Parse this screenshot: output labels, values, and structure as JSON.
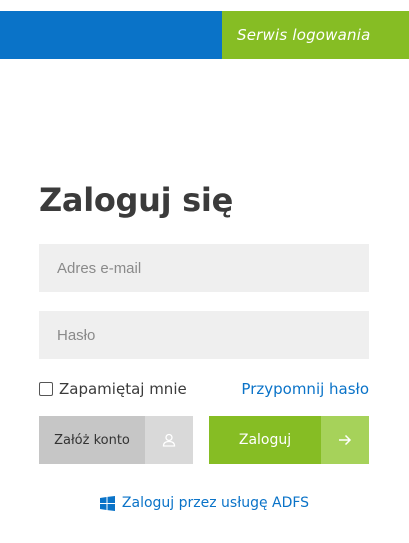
{
  "header": {
    "title": "Serwis logowania",
    "colors": {
      "primary": "#0a73c8",
      "accent": "#86bd24"
    }
  },
  "login": {
    "title": "Zaloguj się",
    "email_placeholder": "Adres e-mail",
    "email_value": "",
    "password_placeholder": "Hasło",
    "password_value": "",
    "remember_label": "Zapamiętaj mnie",
    "remember_checked": false,
    "reset_label": "Przypomnij hasło",
    "register_label": "Załóż konto",
    "register_icon": "user-icon",
    "submit_label": "Zaloguj",
    "submit_icon": "arrow-right-icon",
    "adfs_label": "Zaloguj przez usługę ADFS",
    "adfs_icon": "windows-icon"
  }
}
